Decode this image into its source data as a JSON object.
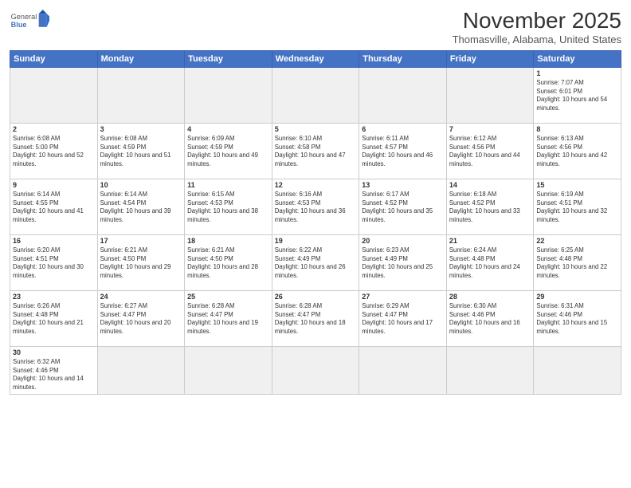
{
  "header": {
    "logo_general": "General",
    "logo_blue": "Blue",
    "month": "November 2025",
    "location": "Thomasville, Alabama, United States"
  },
  "days_of_week": [
    "Sunday",
    "Monday",
    "Tuesday",
    "Wednesday",
    "Thursday",
    "Friday",
    "Saturday"
  ],
  "weeks": [
    [
      {
        "day": "",
        "empty": true
      },
      {
        "day": "",
        "empty": true
      },
      {
        "day": "",
        "empty": true
      },
      {
        "day": "",
        "empty": true
      },
      {
        "day": "",
        "empty": true
      },
      {
        "day": "",
        "empty": true
      },
      {
        "day": "1",
        "sunrise": "7:07 AM",
        "sunset": "6:01 PM",
        "daylight": "10 hours and 54 minutes."
      }
    ],
    [
      {
        "day": "2",
        "sunrise": "6:08 AM",
        "sunset": "5:00 PM",
        "daylight": "10 hours and 52 minutes."
      },
      {
        "day": "3",
        "sunrise": "6:08 AM",
        "sunset": "4:59 PM",
        "daylight": "10 hours and 51 minutes."
      },
      {
        "day": "4",
        "sunrise": "6:09 AM",
        "sunset": "4:59 PM",
        "daylight": "10 hours and 49 minutes."
      },
      {
        "day": "5",
        "sunrise": "6:10 AM",
        "sunset": "4:58 PM",
        "daylight": "10 hours and 47 minutes."
      },
      {
        "day": "6",
        "sunrise": "6:11 AM",
        "sunset": "4:57 PM",
        "daylight": "10 hours and 46 minutes."
      },
      {
        "day": "7",
        "sunrise": "6:12 AM",
        "sunset": "4:56 PM",
        "daylight": "10 hours and 44 minutes."
      },
      {
        "day": "8",
        "sunrise": "6:13 AM",
        "sunset": "4:56 PM",
        "daylight": "10 hours and 42 minutes."
      }
    ],
    [
      {
        "day": "9",
        "sunrise": "6:14 AM",
        "sunset": "4:55 PM",
        "daylight": "10 hours and 41 minutes."
      },
      {
        "day": "10",
        "sunrise": "6:14 AM",
        "sunset": "4:54 PM",
        "daylight": "10 hours and 39 minutes."
      },
      {
        "day": "11",
        "sunrise": "6:15 AM",
        "sunset": "4:53 PM",
        "daylight": "10 hours and 38 minutes."
      },
      {
        "day": "12",
        "sunrise": "6:16 AM",
        "sunset": "4:53 PM",
        "daylight": "10 hours and 36 minutes."
      },
      {
        "day": "13",
        "sunrise": "6:17 AM",
        "sunset": "4:52 PM",
        "daylight": "10 hours and 35 minutes."
      },
      {
        "day": "14",
        "sunrise": "6:18 AM",
        "sunset": "4:52 PM",
        "daylight": "10 hours and 33 minutes."
      },
      {
        "day": "15",
        "sunrise": "6:19 AM",
        "sunset": "4:51 PM",
        "daylight": "10 hours and 32 minutes."
      }
    ],
    [
      {
        "day": "16",
        "sunrise": "6:20 AM",
        "sunset": "4:51 PM",
        "daylight": "10 hours and 30 minutes."
      },
      {
        "day": "17",
        "sunrise": "6:21 AM",
        "sunset": "4:50 PM",
        "daylight": "10 hours and 29 minutes."
      },
      {
        "day": "18",
        "sunrise": "6:21 AM",
        "sunset": "4:50 PM",
        "daylight": "10 hours and 28 minutes."
      },
      {
        "day": "19",
        "sunrise": "6:22 AM",
        "sunset": "4:49 PM",
        "daylight": "10 hours and 26 minutes."
      },
      {
        "day": "20",
        "sunrise": "6:23 AM",
        "sunset": "4:49 PM",
        "daylight": "10 hours and 25 minutes."
      },
      {
        "day": "21",
        "sunrise": "6:24 AM",
        "sunset": "4:48 PM",
        "daylight": "10 hours and 24 minutes."
      },
      {
        "day": "22",
        "sunrise": "6:25 AM",
        "sunset": "4:48 PM",
        "daylight": "10 hours and 22 minutes."
      }
    ],
    [
      {
        "day": "23",
        "sunrise": "6:26 AM",
        "sunset": "4:48 PM",
        "daylight": "10 hours and 21 minutes."
      },
      {
        "day": "24",
        "sunrise": "6:27 AM",
        "sunset": "4:47 PM",
        "daylight": "10 hours and 20 minutes."
      },
      {
        "day": "25",
        "sunrise": "6:28 AM",
        "sunset": "4:47 PM",
        "daylight": "10 hours and 19 minutes."
      },
      {
        "day": "26",
        "sunrise": "6:28 AM",
        "sunset": "4:47 PM",
        "daylight": "10 hours and 18 minutes."
      },
      {
        "day": "27",
        "sunrise": "6:29 AM",
        "sunset": "4:47 PM",
        "daylight": "10 hours and 17 minutes."
      },
      {
        "day": "28",
        "sunrise": "6:30 AM",
        "sunset": "4:46 PM",
        "daylight": "10 hours and 16 minutes."
      },
      {
        "day": "29",
        "sunrise": "6:31 AM",
        "sunset": "4:46 PM",
        "daylight": "10 hours and 15 minutes."
      }
    ],
    [
      {
        "day": "30",
        "sunrise": "6:32 AM",
        "sunset": "4:46 PM",
        "daylight": "10 hours and 14 minutes."
      },
      {
        "day": "",
        "empty": true
      },
      {
        "day": "",
        "empty": true
      },
      {
        "day": "",
        "empty": true
      },
      {
        "day": "",
        "empty": true
      },
      {
        "day": "",
        "empty": true
      },
      {
        "day": "",
        "empty": true
      }
    ]
  ],
  "labels": {
    "sunrise": "Sunrise:",
    "sunset": "Sunset:",
    "daylight": "Daylight:"
  }
}
